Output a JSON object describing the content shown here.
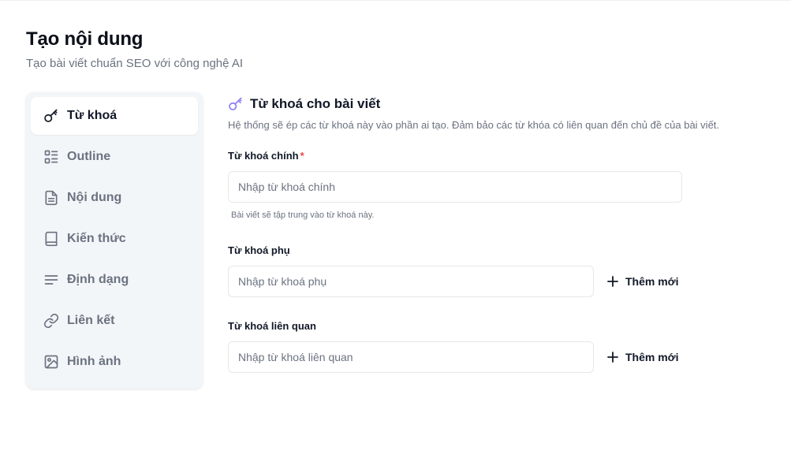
{
  "page": {
    "title": "Tạo nội dung",
    "subtitle": "Tạo bài viết chuẩn SEO với công nghệ AI"
  },
  "sidebar": {
    "items": [
      {
        "label": "Từ khoá",
        "icon": "key-icon",
        "active": true
      },
      {
        "label": "Outline",
        "icon": "outline-list-icon",
        "active": false
      },
      {
        "label": "Nội dung",
        "icon": "document-icon",
        "active": false
      },
      {
        "label": "Kiến thức",
        "icon": "book-icon",
        "active": false
      },
      {
        "label": "Định dạng",
        "icon": "format-lines-icon",
        "active": false
      },
      {
        "label": "Liên kết",
        "icon": "link-icon",
        "active": false
      },
      {
        "label": "Hình ảnh",
        "icon": "image-icon",
        "active": false
      }
    ]
  },
  "section": {
    "title": "Từ khoá cho bài viết",
    "icon": "key-icon",
    "description": "Hệ thống sẽ ép các từ khoá này vào phần ai tạo. Đảm bảo các từ khóa có liên quan đến chủ đề của bài viết."
  },
  "fields": {
    "main_keyword": {
      "label": "Từ khoá chính",
      "required_mark": "*",
      "value": "",
      "placeholder": "Nhập từ khoá chính",
      "hint": "Bài viết sẽ tập trung vào từ khoá này."
    },
    "secondary_keyword": {
      "label": "Từ khoá phụ",
      "value": "",
      "placeholder": "Nhập từ khoá phụ",
      "add_label": "Thêm mới"
    },
    "related_keyword": {
      "label": "Từ khoá liên quan",
      "value": "",
      "placeholder": "Nhập từ khoá liên quan",
      "add_label": "Thêm mới"
    }
  },
  "colors": {
    "accent_icon": "#8b7cf6",
    "required": "#ef4444",
    "sidebar_bg": "#f3f6f9",
    "muted_text": "#6b7280"
  }
}
